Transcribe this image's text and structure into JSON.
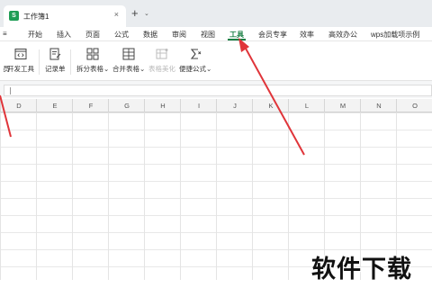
{
  "tabbar": {
    "doc_icon": "S",
    "doc_name": "工作簿1",
    "close_icon": "×",
    "add_icon": "+",
    "more_icon": "⌄"
  },
  "menu": [
    {
      "label": "≡"
    },
    {
      "label": "开始"
    },
    {
      "label": "插入"
    },
    {
      "label": "页面"
    },
    {
      "label": "公式"
    },
    {
      "label": "数据"
    },
    {
      "label": "审阅"
    },
    {
      "label": "视图"
    },
    {
      "label": "工具",
      "active": true
    },
    {
      "label": "会员专享"
    },
    {
      "label": "效率"
    },
    {
      "label": "高效办公"
    },
    {
      "label": "wps加载项示例"
    }
  ],
  "toolbar": {
    "partial_left": "员",
    "developer": "开发工具",
    "record": "记录单",
    "split_table": "拆分表格",
    "merge_table": "合并表格",
    "beautify_table": "表格美化",
    "quick_formula": "便捷公式"
  },
  "dropdown_icon": "⌄",
  "columns": [
    "D",
    "E",
    "F",
    "G",
    "H",
    "I",
    "J",
    "K",
    "L",
    "M",
    "N",
    "O"
  ],
  "watermark": "软件下载",
  "accent_color": "#1a7f45",
  "arrow_color": "#e0353a"
}
